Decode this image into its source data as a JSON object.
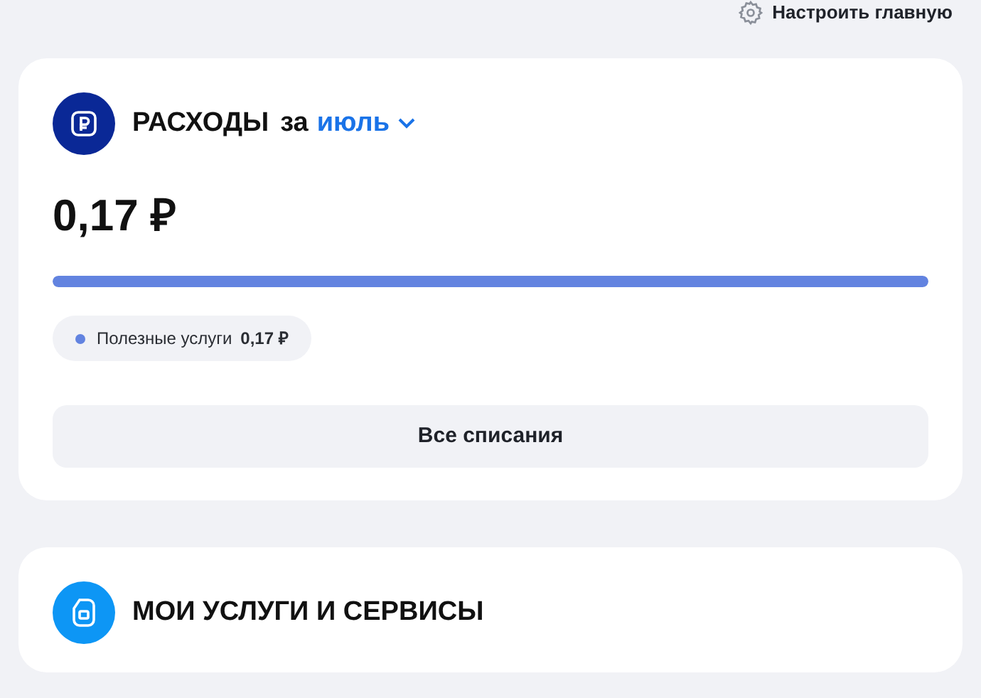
{
  "header_link": {
    "label": "Настроить главную"
  },
  "expenses": {
    "title": "РАСХОДЫ",
    "period_prefix": "за",
    "period": "июль",
    "amount": "0,17 ₽",
    "level": 1,
    "categories": [
      {
        "label": "Полезные услуги",
        "amount": "0,17 ₽",
        "color": "#6283e0"
      }
    ],
    "button": "Все списания"
  },
  "services": {
    "title": "МОИ УСЛУГИ И СЕРВИСЫ"
  }
}
